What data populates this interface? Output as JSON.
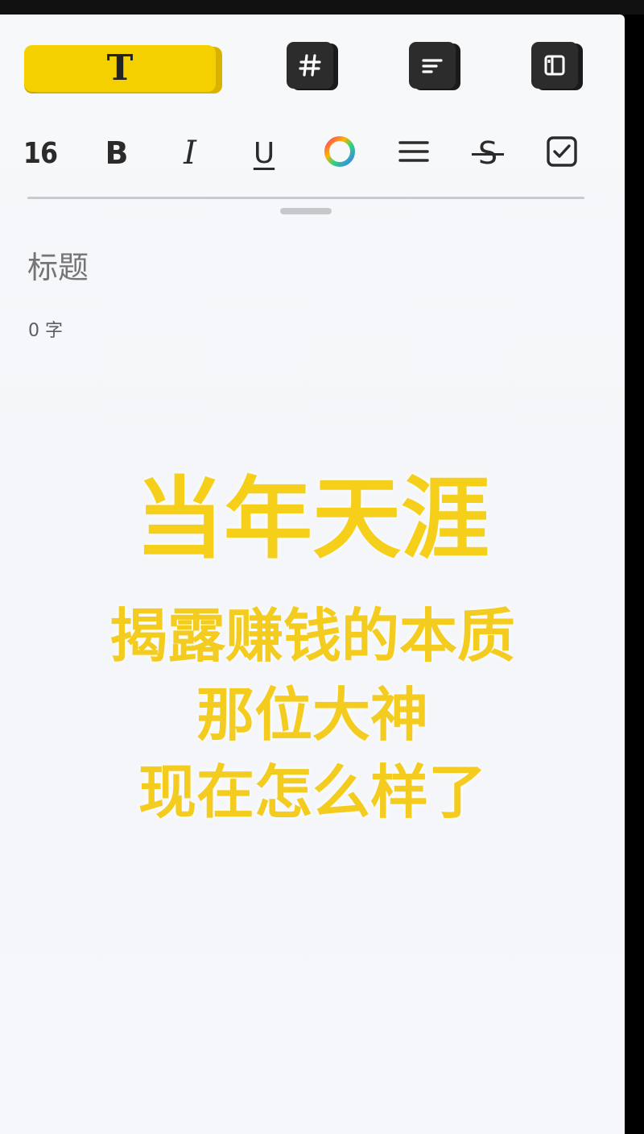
{
  "toolbar_top": {
    "text_style_button": {
      "glyph": "T",
      "color": "#f5d000"
    },
    "icon_buttons": [
      {
        "icon": "hashtag-icon"
      },
      {
        "icon": "list-lines-icon"
      },
      {
        "icon": "columns-panel-icon"
      }
    ]
  },
  "format_bar": {
    "font_size": "16",
    "bold": "B",
    "italic": "I",
    "underline": "U",
    "color_icon": "color-wheel-icon",
    "align_icon": "align-lines-icon",
    "strike": "S",
    "checkbox_icon": "checkbox-icon"
  },
  "editor": {
    "title_placeholder": "标题",
    "word_count": "0 字"
  },
  "overlay": {
    "headline": "当年天涯",
    "lines": [
      "揭露赚钱的本质",
      "那位大神",
      "现在怎么样了"
    ],
    "color": "#f5cf1a"
  }
}
